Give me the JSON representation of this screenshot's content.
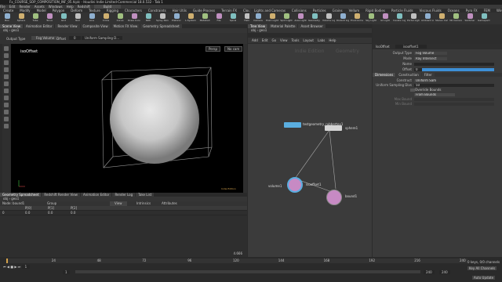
{
  "window": {
    "title": "Fx_COURSE_SOP_COMPOSITION_INF_05.hiplc - Houdini Indie Limited-Commercial 18.0.532 - Tab 1"
  },
  "menu": [
    "File",
    "Edit",
    "Render",
    "Assets",
    "Windows",
    "Help",
    "Redshift",
    "Indie"
  ],
  "desktop": {
    "label": "Build"
  },
  "shelf_tabs_left": [
    "Create",
    "Modify",
    "Model",
    "Polygon",
    "Deform",
    "Texture",
    "Rigging",
    "Characters",
    "Constraints",
    "Hair Utils",
    "Guide Process",
    "Terrain FX",
    "Cloud FX",
    "Volume"
  ],
  "shelf_tabs_right": [
    "Lights and Cameras",
    "Collisions",
    "Particles",
    "Grains",
    "Vellum",
    "Rigid Bodies",
    "Particle Fluids",
    "Viscous Fluids",
    "Oceans",
    "Pyro FX",
    "FEM",
    "Wires",
    "Crowds",
    "Drive Simulation"
  ],
  "shelf_tools_left": [
    "Box",
    "Sphere",
    "Tube",
    "Torus",
    "Grid",
    "Null",
    "Line",
    "Circle",
    "Curve",
    "Draw Curve",
    "Path",
    "Spray Paint",
    "Platonic",
    "L-System",
    "Metaball",
    "File",
    "Spiral",
    "Helix"
  ],
  "shelf_tools_right": [
    "Camera",
    "Point Light",
    "Spot Light",
    "Area Light",
    "Geometry Light",
    "Volume Light",
    "Distant Light",
    "Environment Light",
    "Sky Light",
    "GI Light",
    "Caustic Light",
    "Portal Light",
    "Ambient Light",
    "Stereo Camera",
    "VR Camera",
    "Switcher",
    "Gamepad Camera"
  ],
  "viewport": {
    "tabs": [
      "Scene View",
      "Animation Editor",
      "Render View",
      "Composite View",
      "Motion FX View",
      "Geometry Spreadsheet"
    ],
    "path": [
      "obj",
      "geo1"
    ],
    "toolbar": {
      "output_type_label": "Output Type",
      "output_type_value": "Fog Volume",
      "offset_label": "Offset",
      "offset_value": "0",
      "uniform_label": "Uniform Sampling D..."
    },
    "node_label": "isoOffset",
    "persp_label": "Persp",
    "cam_label": "No cam",
    "license_label": "Indie Edition"
  },
  "bottom_left": {
    "tabs": [
      "Geometry Spreadsheet",
      "Redshift Render View",
      "Animation Editor",
      "Render Log",
      "Take List"
    ],
    "path": [
      "obj",
      "geo1"
    ],
    "node_label": "Node: bound1",
    "group_label": "Group",
    "view_label": "View",
    "intrinsics_label": "Intrinsics",
    "attributes_label": "Attributes",
    "columns": [
      "",
      "P[0]",
      "P[1]",
      "P[2]"
    ],
    "rows": [
      [
        "0",
        "0.0",
        "0.0",
        "0.0"
      ]
    ],
    "count_label": "4.666"
  },
  "network": {
    "tabs": [
      "Tree View",
      "Material Palette",
      "Asset Browser"
    ],
    "path": [
      "obj",
      "geo1"
    ],
    "menu": [
      "Add",
      "Edit",
      "Go",
      "View",
      "Tools",
      "Layout",
      "Labs",
      "Help"
    ],
    "watermark_left": "Indie Edition",
    "watermark_right": "Geometry",
    "nodes": {
      "testgeometry": "testgeometry_rubbertoy1",
      "sphere": "sphere1",
      "volume": "volume1",
      "isooffset": "isooffset1",
      "bound": "bound1"
    }
  },
  "params": {
    "header_type": "IsoOffset",
    "header_name": "isooffset1",
    "rows": [
      {
        "label": "Output Type",
        "value": "Fog Volume"
      },
      {
        "label": "Mode",
        "value": "Ray Intersect"
      },
      {
        "label": "Name",
        "value": ""
      },
      {
        "label": "Offset",
        "value": "0"
      }
    ],
    "tabs": [
      "Dimensions",
      "Construction",
      "Filter"
    ],
    "construct_label": "Construct",
    "construct_value": "Uniform Sampling",
    "uniform_divs_label": "Uniform Sampling Divs",
    "uniform_divs_value": "50",
    "override_label": "Override Bounds",
    "max_bound_label": "Max Bound",
    "min_bound_label": "Min Bound",
    "from_bounds_label": "From Bounds"
  },
  "timeline": {
    "frame": "1",
    "ticks": [
      "1",
      "24",
      "48",
      "72",
      "96",
      "120",
      "144",
      "168",
      "192",
      "216",
      "240"
    ],
    "start": "1",
    "end": "240",
    "end2": "240",
    "keys_label": "0 keys, 0/0 channels",
    "key_all_label": "Key All Channels",
    "auto_update": "Auto Update"
  },
  "colors": {
    "accent": "#5aaee0",
    "param_blue": "#3d8fd6",
    "node_pink": "#c78ac4",
    "timeline_orange": "#d4a24b"
  }
}
